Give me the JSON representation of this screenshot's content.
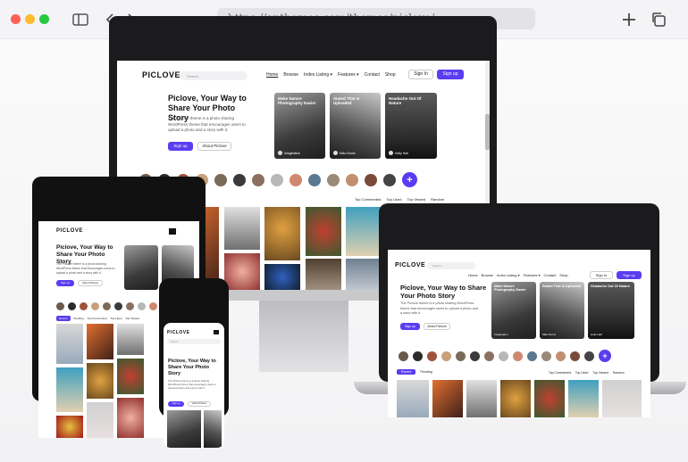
{
  "browser": {
    "url": "https://anthemes.com/themes/piclove/",
    "traffic_lights": [
      "#ff5f57",
      "#febc2e",
      "#28c840"
    ]
  },
  "site": {
    "logo": "PICLOVE",
    "search_placeholder": "Search...",
    "nav": [
      "Home",
      "Browse",
      "Index Listing ▾",
      "Features ▾",
      "Contact",
      "Shop"
    ],
    "signin": "Sign In",
    "signup": "Sign up",
    "hero_title": "Piclove, Your Way to Share Your Photo Story",
    "hero_desc": "The Piclove theme is a photo sharing WordPress theme that encourages users to upload a photo and a story with it.",
    "hero_btn_signup": "Sign up",
    "hero_btn_about": "About Piclove",
    "cards": [
      {
        "title": "Make Nature Photography Easier",
        "user": "Imagination"
      },
      {
        "title": "Stated That Is Uploaded",
        "user": "Miko Norris"
      },
      {
        "title": "Headache Out Of Nature",
        "user": "Holly Hall"
      }
    ],
    "tabs_left": [
      "Recent",
      "Pending"
    ],
    "tabs_right": [
      "Top Commented",
      "Top Liked",
      "Top Viewed",
      "Random"
    ],
    "plus": "+",
    "accent": "#5a3df0"
  },
  "icons": [
    "sidebar-icon",
    "chevron-left-icon",
    "chevron-right-icon",
    "plus-icon",
    "copy-tabs-icon",
    "search-icon"
  ]
}
